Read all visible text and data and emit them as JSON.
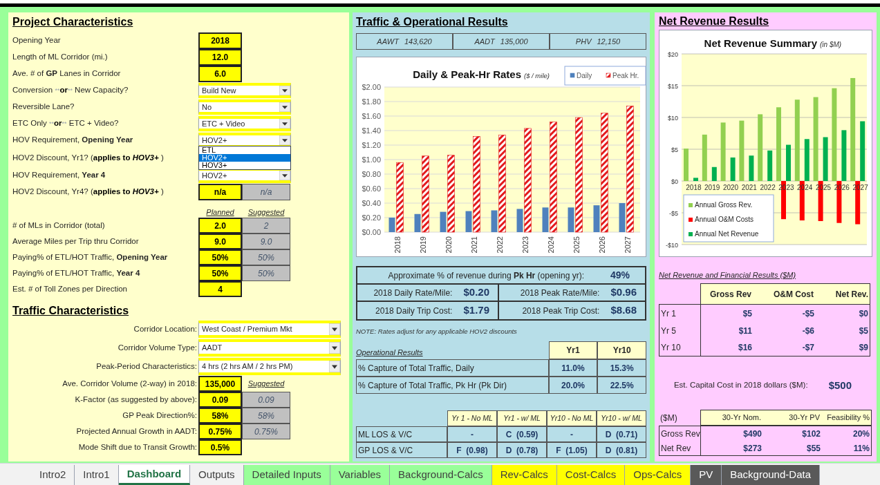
{
  "project": {
    "title": "Project Characteristics",
    "rows": [
      {
        "kind": "input",
        "label": "Opening Year",
        "value": "2018"
      },
      {
        "kind": "input",
        "label": "Length of ML Corridor (mi.)",
        "value": "12.0"
      },
      {
        "kind": "input",
        "label": "Ave. # of **GP** Lanes in Corridor",
        "value": "6.0"
      },
      {
        "kind": "dropdown",
        "label_parts": [
          {
            "text": "Conversion "
          },
          {
            "text": "**",
            "kind": "faint"
          },
          {
            "text": "or",
            "kind": "bold"
          },
          {
            "text": "**",
            "kind": "faint"
          },
          {
            "text": " New Capacity?"
          }
        ],
        "value": "Build New",
        "expanded": false
      },
      {
        "kind": "dropdown",
        "label": "Reversible Lane?",
        "value": "No",
        "expanded": false
      },
      {
        "kind": "dropdown",
        "label_parts": [
          {
            "text": "ETC Only "
          },
          {
            "text": "**",
            "kind": "faint"
          },
          {
            "text": "or",
            "kind": "bold"
          },
          {
            "text": "**",
            "kind": "faint"
          },
          {
            "text": " ETC + Video?"
          }
        ],
        "value": "ETC + Video",
        "expanded": false
      },
      {
        "kind": "dropdown",
        "label": "HOV Requirement, **Opening Year**",
        "value": "HOV2+",
        "expanded": true,
        "options": [
          {
            "label": "ETL",
            "selected": false
          },
          {
            "label": "HOV2+",
            "selected": true
          },
          {
            "label": "HOV3+",
            "selected": false
          }
        ]
      },
      {
        "kind": "label",
        "label_parts": [
          {
            "text": "HOV2 Discount, Yr1? ("
          },
          {
            "text": "applies to ",
            "kind": "bold"
          },
          {
            "text": "HOV3+",
            "kind": "bold-italic"
          },
          {
            "text": " )"
          }
        ]
      },
      {
        "kind": "dropdown",
        "label": "HOV Requirement, **Year 4**",
        "value": "HOV2+",
        "expanded": false
      },
      {
        "kind": "input",
        "label_parts": [
          {
            "text": "HOV2 Discount, Yr4? ("
          },
          {
            "text": "applies to ",
            "kind": "bold"
          },
          {
            "text": "HOV3+",
            "kind": "bold-italic"
          },
          {
            "text": " )"
          }
        ],
        "value": "n/a",
        "suggested": "n/a"
      },
      {
        "kind": "header",
        "planned": "Planned",
        "suggested": "Suggested"
      },
      {
        "kind": "input",
        "label": "# of MLs in Corridor (total)",
        "value": "2.0",
        "suggested": "2"
      },
      {
        "kind": "input",
        "label": "Average Miles per Trip thru Corridor",
        "value": "9.0",
        "suggested": "9.0"
      },
      {
        "kind": "input",
        "label": "Paying% of ETL/HOT Traffic, **Opening Year**",
        "value": "50%",
        "suggested": "50%"
      },
      {
        "kind": "input",
        "label": "Paying% of ETL/HOT Traffic, **Year 4**",
        "value": "50%",
        "suggested": "50%"
      },
      {
        "kind": "input",
        "label": "Est. # of Toll Zones per Direction",
        "value": "4"
      }
    ]
  },
  "traffic": {
    "title": "Traffic Characteristics",
    "rows": [
      {
        "kind": "dropdown",
        "label": "Corridor Location:",
        "value": "West Coast / Premium Mkt",
        "expanded": false
      },
      {
        "kind": "dropdown",
        "label": "Corridor Volume Type:",
        "value": "AADT",
        "expanded": false
      },
      {
        "kind": "dropdown",
        "label": "Peak-Period Characteristics:",
        "value": "4 hrs (2 hrs AM / 2 hrs PM)",
        "expanded": false
      },
      {
        "kind": "input",
        "label": "Ave. Corridor Volume (2-way) in 2018:",
        "value": "135,000",
        "suggested_header": "Suggested"
      },
      {
        "kind": "input",
        "label": "K-Factor (as suggested by above):",
        "value": "0.09",
        "suggested": "0.09"
      },
      {
        "kind": "input",
        "label": "GP Peak Direction%:",
        "value": "58%",
        "suggested": "58%"
      },
      {
        "kind": "input",
        "label": "Projected Annual Growth in AADT:",
        "value": "0.75%",
        "suggested": "0.75%"
      },
      {
        "kind": "input",
        "label": "Mode Shift due to Transit Growth:",
        "value": "0.5%"
      }
    ]
  },
  "traffic_results": {
    "title": "Traffic & Operational Results",
    "stats": [
      {
        "label": "AAWT",
        "value": "143,620"
      },
      {
        "label": "AADT",
        "value": "135,000"
      },
      {
        "label": "PHV",
        "value": "12,150"
      }
    ],
    "rates_chart": {
      "units": "($ / mile)",
      "chart_data": {
        "type": "bar",
        "title": "Daily & Peak-Hr Rates",
        "categories": [
          "2018",
          "2019",
          "2020",
          "2021",
          "2022",
          "2023",
          "2024",
          "2025",
          "2026",
          "2027"
        ],
        "series": [
          {
            "name": "Daily",
            "color": "#4f81bd",
            "values": [
              0.2,
              0.25,
              0.28,
              0.29,
              0.3,
              0.32,
              0.34,
              0.34,
              0.37,
              0.4
            ]
          },
          {
            "name": "Peak Hr.",
            "color": "#e31a1c",
            "values": [
              0.96,
              1.05,
              1.06,
              1.32,
              1.34,
              1.43,
              1.52,
              1.58,
              1.64,
              1.74
            ]
          }
        ],
        "grid": true,
        "legend": true,
        "ylim": [
          0,
          2
        ],
        "yticks": [
          {
            "value": 0,
            "label": "$0.00"
          },
          {
            "value": 0.2,
            "label": "$0.20"
          },
          {
            "value": 0.4,
            "label": "$0.40"
          },
          {
            "value": 0.6,
            "label": "$0.60"
          },
          {
            "value": 0.8,
            "label": "$0.80"
          },
          {
            "value": 1,
            "label": "$1.00"
          },
          {
            "value": 1.2,
            "label": "$1.20"
          },
          {
            "value": 1.4,
            "label": "$1.40"
          },
          {
            "value": 1.6,
            "label": "$1.60"
          },
          {
            "value": 1.8,
            "label": "$1.80"
          },
          {
            "value": 2,
            "label": "$2.00"
          }
        ]
      }
    },
    "revenue_share": {
      "label": "Approximate % of revenue during **Pk Hr** (opening yr):",
      "value": "49%"
    },
    "rates": [
      {
        "cells": [
          {
            "label": "2018 Daily Rate/Mile:",
            "value": "$0.20"
          },
          {
            "label": "2018 Peak Rate/Mile:",
            "value": "$0.96"
          }
        ]
      },
      {
        "cells": [
          {
            "label": "2018 Daily Trip Cost:",
            "value": "$1.79"
          },
          {
            "label": "2018 Peak Trip Cost:",
            "value": "$8.68"
          }
        ]
      }
    ],
    "note": "NOTE: Rates adjust for any applicable HOV2 discounts",
    "operational": {
      "title": "Operational Results",
      "columns": [
        "Yr1",
        "Yr10"
      ],
      "rows": [
        {
          "label": "% Capture of Total Traffic, Daily",
          "values": [
            "11.0%",
            "15.3%"
          ]
        },
        {
          "label": "% Capture of Total Traffic, Pk Hr (Pk Dir)",
          "values": [
            "20.0%",
            "22.5%"
          ]
        }
      ]
    },
    "los": {
      "columns": [
        "Yr 1 - No ML",
        "Yr1 - w/ ML",
        "Yr10 - No ML",
        "Yr10 - w/ ML"
      ],
      "rows": [
        {
          "label": "ML LOS & V/C",
          "values": [
            "-",
            "C  (0.59)",
            "-",
            "D  (0.71)"
          ]
        },
        {
          "label": "GP LOS & V/C",
          "values": [
            "F  (0.98)",
            "D  (0.78)",
            "F  (1.05)",
            "D  (0.81)"
          ]
        }
      ]
    }
  },
  "net_revenue": {
    "title": "Net Revenue Results",
    "summary_chart": {
      "units": "(in $M)",
      "chart_data": {
        "type": "bar",
        "title": "Net Revenue Summary",
        "categories": [
          "2018",
          "2019",
          "2020",
          "2021",
          "2022",
          "2023",
          "2024",
          "2025",
          "2026",
          "2027"
        ],
        "series": [
          {
            "name": "Annual Gross Rev.",
            "color": "#92d050",
            "values": [
              5.1,
              7.3,
              9.2,
              9.5,
              10.5,
              11.6,
              12.8,
              13.2,
              14.6,
              16.2
            ]
          },
          {
            "name": "Annual O&M Costs",
            "color": "#ff0000",
            "values": [
              null,
              null,
              null,
              null,
              null,
              -6.0,
              -6.2,
              -6.3,
              -6.6,
              -6.8
            ]
          },
          {
            "name": "Annual Net Revenue",
            "color": "#00b050",
            "values": [
              0.5,
              2.2,
              3.7,
              4.0,
              4.8,
              5.7,
              6.6,
              6.9,
              8.0,
              9.4
            ]
          }
        ],
        "grid": true,
        "legend": true,
        "ylim": [
          -10,
          20
        ],
        "yticks": [
          {
            "value": -10,
            "label": "-$10"
          },
          {
            "value": -5,
            "label": "-$5"
          },
          {
            "value": 0,
            "label": "$0"
          },
          {
            "value": 5,
            "label": "$5"
          },
          {
            "value": 10,
            "label": "$10"
          },
          {
            "value": 15,
            "label": "$15"
          },
          {
            "value": 20,
            "label": "$20"
          }
        ]
      }
    },
    "financial": {
      "title": "Net Revenue and Financial Results ($M)",
      "columns": [
        "Gross Rev",
        "O&M Cost",
        "Net Rev."
      ],
      "rows": [
        {
          "label": "Yr 1",
          "values": [
            "$5",
            "-$5",
            "$0"
          ]
        },
        {
          "label": "Yr 5",
          "values": [
            "$11",
            "-$6",
            "$5"
          ]
        },
        {
          "label": "Yr 10",
          "values": [
            "$16",
            "-$7",
            "$9"
          ]
        }
      ]
    },
    "capital_cost": {
      "label": "Est. Capital Cost in 2018 dollars ($M):",
      "value": "$500"
    },
    "totals": {
      "corner": "($M)",
      "columns": [
        "30-Yr Nom.",
        "30-Yr PV",
        "Feasibility %"
      ],
      "rows": [
        {
          "label": "Gross Rev",
          "values": [
            "$490",
            "$102",
            "20%"
          ]
        },
        {
          "label": "Net Rev",
          "values": [
            "$273",
            "$55",
            "11%"
          ]
        }
      ]
    }
  },
  "tabs": [
    {
      "label": "Intro2",
      "color": "#f2f2f2",
      "selected": false
    },
    {
      "label": "Intro1",
      "color": "#f2f2f2",
      "selected": false
    },
    {
      "label": "Dashboard",
      "color": "#ffffff",
      "selected": true
    },
    {
      "label": "Outputs",
      "color": "#f2f2f2",
      "selected": false
    },
    {
      "label": "Detailed Inputs",
      "color": "#99ff99",
      "selected": false
    },
    {
      "label": "Variables",
      "color": "#99ff99",
      "selected": false
    },
    {
      "label": "Background-Calcs",
      "color": "#99ff99",
      "selected": false
    },
    {
      "label": "Rev-Calcs",
      "color": "#ffff00",
      "selected": false
    },
    {
      "label": "Cost-Calcs",
      "color": "#ffff00",
      "selected": false
    },
    {
      "label": "Ops-Calcs",
      "color": "#ffff00",
      "selected": false
    },
    {
      "label": "PV",
      "color": "#595959",
      "selected": false
    },
    {
      "label": "Background-Data",
      "color": "#595959",
      "selected": false
    }
  ]
}
